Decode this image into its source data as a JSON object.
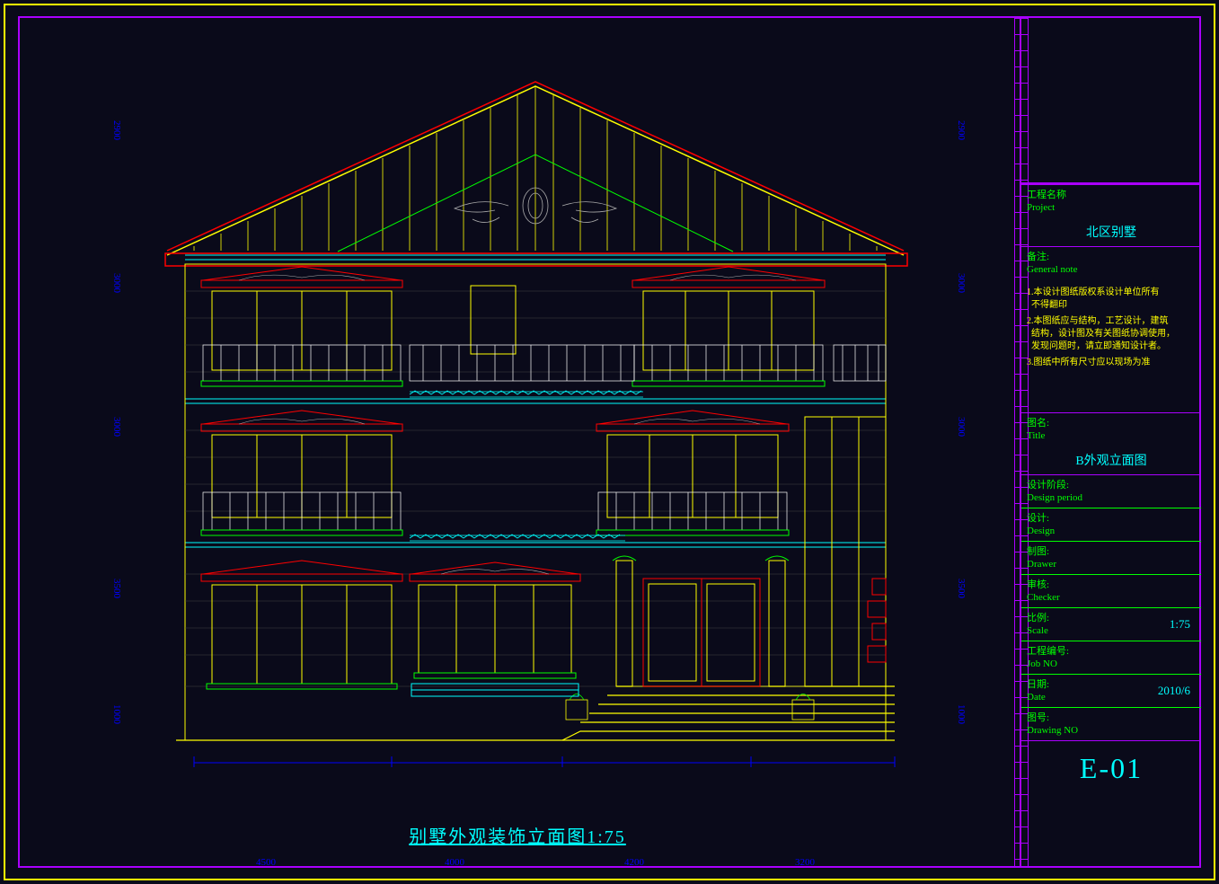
{
  "titleblock": {
    "project_label": "工程名称\nProject",
    "project_value": "北区别墅",
    "notes_label": "备注:\nGeneral note",
    "notes": [
      "1.本设计图纸版权系设计单位所有\n  不得翻印",
      "2.本图纸应与结构，工艺设计，建筑\n  结构，设计图及有关图纸协调使用，\n  发现问题时，请立即通知设计者。",
      "3.图纸中所有尺寸应以现场为准"
    ],
    "title_label": "图名:\nTitle",
    "title_value": "B外观立面图",
    "design_period": "设计阶段:\nDesign period",
    "design": "设计:\nDesign",
    "drawer": "制图:\nDrawer",
    "checker": "审核:\nChecker",
    "scale_label": "比例:\nScale",
    "scale_value": "1:75",
    "jobno": "工程编号:\nJob NO",
    "date_label": "日期:\nDate",
    "date_value": "2010/6",
    "dwgno": "图号:\nDrawing NO",
    "sheet": "E-01"
  },
  "caption": "别墅外观装饰立面图1:75",
  "dims": {
    "h1": "4500",
    "h2": "4000",
    "h3": "4200",
    "h4": "3200",
    "vL1": "2900",
    "vL2": "3000",
    "vL3": "3000",
    "vL4": "3500",
    "vL5": "1000",
    "vR1": "2900",
    "vR2": "3000",
    "vR3": "3000",
    "vR4": "3500",
    "vR5": "1000"
  }
}
